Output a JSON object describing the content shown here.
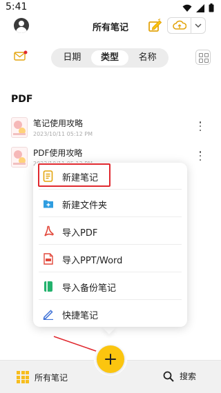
{
  "status_bar": {
    "time": "5:41",
    "icons": [
      "wifi-icon",
      "signal-icon",
      "battery-icon"
    ]
  },
  "header": {
    "title": "所有笔记",
    "icons": [
      "avatar",
      "new-note-edit-icon",
      "cloud-sync-icon",
      "chevron-down-icon"
    ]
  },
  "toolbar": {
    "tabs": [
      {
        "label": "日期",
        "active": false
      },
      {
        "label": "类型",
        "active": true
      },
      {
        "label": "名称",
        "active": false
      }
    ],
    "icons": [
      "mail-icon",
      "grid-view-icon"
    ]
  },
  "section": {
    "title": "PDF"
  },
  "notes": [
    {
      "name": "笔记使用攻略",
      "date": "2023/10/11 05:12 PM"
    },
    {
      "name": "PDF使用攻略",
      "date": "2023/10/11 05:12 PM"
    }
  ],
  "popup_menu": {
    "items": [
      {
        "label": "新建笔记",
        "icon": "new-note-icon",
        "highlighted": true
      },
      {
        "label": "新建文件夹",
        "icon": "new-folder-icon",
        "highlighted": false
      },
      {
        "label": "导入PDF",
        "icon": "pdf-icon",
        "highlighted": false
      },
      {
        "label": "导入PPT/Word",
        "icon": "ppt-word-icon",
        "highlighted": false
      },
      {
        "label": "导入备份笔记",
        "icon": "backup-note-icon",
        "highlighted": false
      },
      {
        "label": "快捷笔记",
        "icon": "quick-note-pen-icon",
        "highlighted": false
      }
    ]
  },
  "bottom_nav": {
    "all_notes_label": "所有笔记",
    "search_label": "搜索"
  },
  "colors": {
    "accent_yellow": "#fbc50f",
    "highlight_red": "#e0282e",
    "pdf_red": "#e2473a",
    "folder_blue": "#2f9de0",
    "backup_green": "#23b26d",
    "pen_blue": "#3b6fd6"
  }
}
